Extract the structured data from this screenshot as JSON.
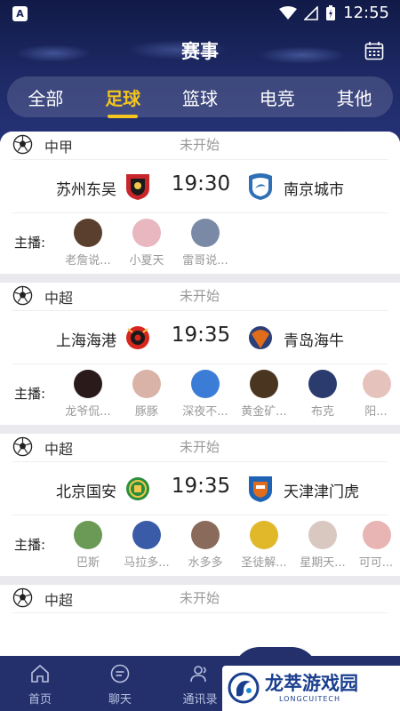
{
  "status_bar": {
    "time": "12:55",
    "badge": "A"
  },
  "header": {
    "title": "赛事"
  },
  "tabs": [
    {
      "label": "全部",
      "active": false
    },
    {
      "label": "足球",
      "active": true
    },
    {
      "label": "篮球",
      "active": false
    },
    {
      "label": "电竞",
      "active": false
    },
    {
      "label": "其他",
      "active": false
    }
  ],
  "streamer_label": "主播:",
  "matches": [
    {
      "league": "中甲",
      "status": "未开始",
      "time": "19:30",
      "home": "苏州东吴",
      "away": "南京城市",
      "home_color": "#c8262b",
      "away_color": "#2f6fb5",
      "streamers": [
        {
          "name": "老詹说...",
          "color": "#5a3f2e"
        },
        {
          "name": "小夏天",
          "color": "#e8b7c0"
        },
        {
          "name": "雷哥说...",
          "color": "#7a8aa6"
        }
      ]
    },
    {
      "league": "中超",
      "status": "未开始",
      "time": "19:35",
      "home": "上海海港",
      "away": "青岛海牛",
      "home_color": "#d7261e",
      "away_color": "#e06d1b",
      "streamers": [
        {
          "name": "龙爷侃...",
          "color": "#2a1a1a"
        },
        {
          "name": "豚豚",
          "color": "#d9b2a8"
        },
        {
          "name": "深夜不...",
          "color": "#3b7cd6"
        },
        {
          "name": "黄金矿...",
          "color": "#4a3520"
        },
        {
          "name": "布克",
          "color": "#2b3b6e"
        },
        {
          "name": "阳...",
          "color": "#e5c3bc"
        }
      ]
    },
    {
      "league": "中超",
      "status": "未开始",
      "time": "19:35",
      "home": "北京国安",
      "away": "天津津门虎",
      "home_color": "#2a8f3c",
      "away_color": "#1f63b5",
      "streamers": [
        {
          "name": "巴斯",
          "color": "#6a9a55"
        },
        {
          "name": "马拉多...",
          "color": "#3a5ca8"
        },
        {
          "name": "水多多",
          "color": "#8a6a5a"
        },
        {
          "name": "圣徒解...",
          "color": "#e0b82a"
        },
        {
          "name": "星期天...",
          "color": "#d8c8c0"
        },
        {
          "name": "可可...",
          "color": "#e8b4b4"
        }
      ]
    },
    {
      "league": "中超",
      "status": "未开始",
      "time": "",
      "home": "",
      "away": "",
      "home_color": "#ffffff",
      "away_color": "#ffffff",
      "streamers": []
    }
  ],
  "bottom_nav": [
    {
      "label": "首页",
      "icon": "home-icon"
    },
    {
      "label": "聊天",
      "icon": "chat-icon"
    },
    {
      "label": "通讯录",
      "icon": "contacts-icon"
    },
    {
      "label": "",
      "icon": "center-icon"
    },
    {
      "label": "",
      "icon": "profile-icon"
    }
  ],
  "watermark": {
    "title": "龙萃游戏园",
    "subtitle": "LONGCUITECH"
  }
}
